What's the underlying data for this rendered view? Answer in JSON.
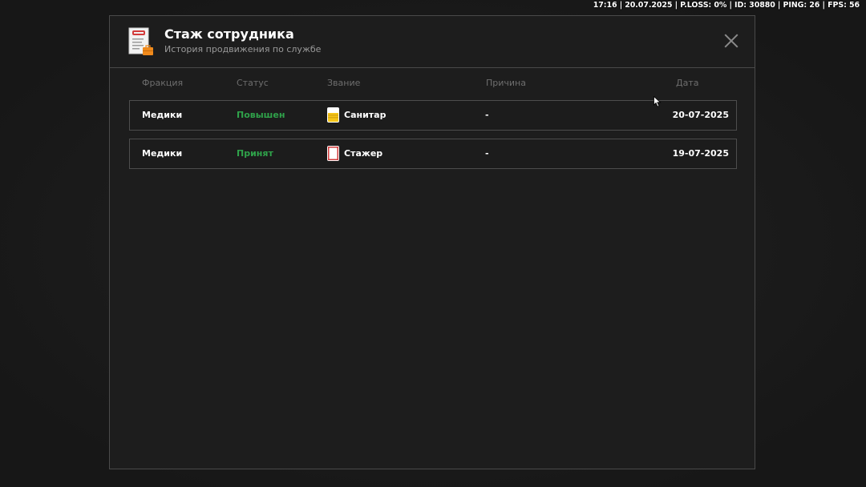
{
  "hud": {
    "text": "17:16 | 20.07.2025 | P.LOSS: 0% | ID: 30880 | PING: 26 | FPS: 56"
  },
  "panel": {
    "title": "Стаж сотрудника",
    "subtitle": "История продвижения по службе"
  },
  "table": {
    "headers": {
      "faction": "Фракция",
      "status": "Статус",
      "rank": "Звание",
      "reason": "Причина",
      "date": "Дата"
    },
    "rows": [
      {
        "faction": "Медики",
        "status": "Повышен",
        "rank": "Санитар",
        "rank_icon": "sanitar-badge-icon",
        "reason": "-",
        "date": "20-07-2025"
      },
      {
        "faction": "Медики",
        "status": "Принят",
        "rank": "Стажер",
        "rank_icon": "trainee-badge-icon",
        "reason": "-",
        "date": "19-07-2025"
      }
    ]
  },
  "colors": {
    "status_green": "#2fa24a",
    "panel_border": "#4a4a4a",
    "background": "#1d1d1d"
  }
}
